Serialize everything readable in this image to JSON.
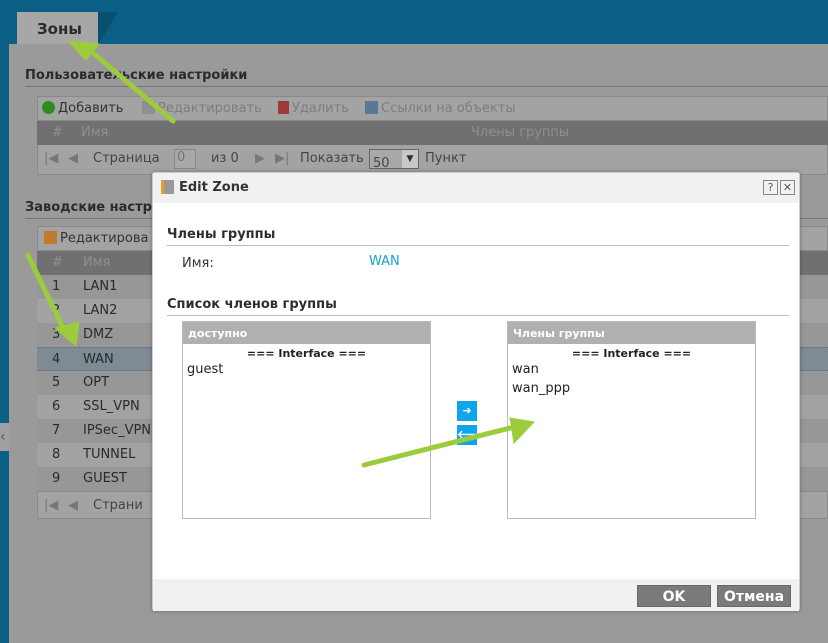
{
  "tab": {
    "label": "Зоны"
  },
  "user_section": {
    "title": "Пользовательские настройки",
    "toolbar": {
      "add": "Добавить",
      "edit": "Редактировать",
      "delete": "Удалить",
      "refs": "Ссылки на объекты"
    },
    "columns": {
      "num": "#",
      "name": "Имя",
      "members": "Члены группы"
    },
    "pager": {
      "page_label": "Страница",
      "page_value": "0",
      "of": "из 0",
      "show": "Показать",
      "per_page": "50",
      "unit": "Пункт"
    }
  },
  "factory_section": {
    "title": "Заводские настро",
    "toolbar": {
      "edit": "Редактирова"
    },
    "columns": {
      "num": "#",
      "name": "Имя"
    },
    "rows": [
      {
        "num": "1",
        "name": "LAN1"
      },
      {
        "num": "2",
        "name": "LAN2"
      },
      {
        "num": "3",
        "name": "DMZ"
      },
      {
        "num": "4",
        "name": "WAN"
      },
      {
        "num": "5",
        "name": "OPT"
      },
      {
        "num": "6",
        "name": "SSL_VPN"
      },
      {
        "num": "7",
        "name": "IPSec_VPN"
      },
      {
        "num": "8",
        "name": "TUNNEL"
      },
      {
        "num": "9",
        "name": "GUEST"
      }
    ],
    "selected_row": "4",
    "pager": {
      "page_label": "Страни"
    }
  },
  "dialog": {
    "title": "Edit Zone",
    "help": "?",
    "close": "✕",
    "members_section": "Члены группы",
    "name_label": "Имя:",
    "name_value": "WAN",
    "list_section": "Список членов группы",
    "available": {
      "header": "доступно",
      "group": "=== Interface ===",
      "items": [
        "guest"
      ]
    },
    "members": {
      "header": "Члены группы",
      "group": "=== Interface ===",
      "items": [
        "wan",
        "wan_ppp"
      ]
    },
    "move_right": "➜",
    "move_left": "🡐",
    "ok": "OK",
    "cancel": "Отмена"
  },
  "colors": {
    "accent": "#10a4ee",
    "link": "#1a9fd0",
    "arrow": "#9ccc3c"
  }
}
